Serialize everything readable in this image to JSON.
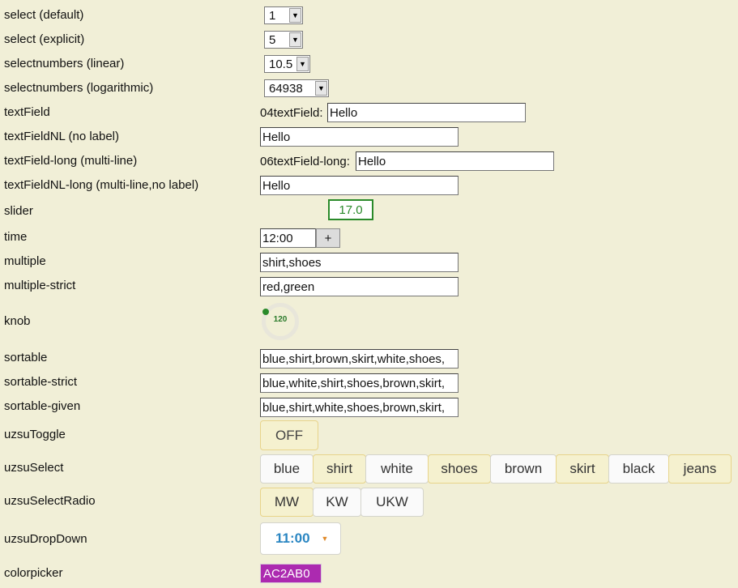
{
  "labels": {
    "select_default": "select (default)",
    "select_explicit": "select (explicit)",
    "selectnumbers_linear": "selectnumbers (linear)",
    "selectnumbers_log": "selectnumbers (logarithmic)",
    "textfield": "textField",
    "textfieldnl": "textFieldNL (no label)",
    "textfield_long": "textField-long (multi-line)",
    "textfieldnl_long": "textFieldNL-long (multi-line,no label)",
    "slider": "slider",
    "time": "time",
    "multiple": "multiple",
    "multiple_strict": "multiple-strict",
    "knob": "knob",
    "sortable": "sortable",
    "sortable_strict": "sortable-strict",
    "sortable_given": "sortable-given",
    "uzsu_toggle": "uzsuToggle",
    "uzsu_select": "uzsuSelect",
    "uzsu_select_radio": "uzsuSelectRadio",
    "uzsu_dropdown": "uzsuDropDown",
    "colorpicker": "colorpicker"
  },
  "values": {
    "select_default": "1",
    "select_explicit": "5",
    "selectnumbers_linear": "10.5",
    "selectnumbers_log": "64938",
    "textfield_prefix": "04textField:",
    "textfield": "Hello",
    "textfieldnl": "Hello",
    "textfield_long_prefix": "06textField-long:",
    "textfield_long": "Hello",
    "textfieldnl_long": "Hello",
    "slider": "17.0",
    "time": "12:00",
    "time_add": "+",
    "multiple": "shirt,shoes",
    "multiple_strict": "red,green",
    "knob": "120",
    "sortable": "blue,shirt,brown,skirt,white,shoes,",
    "sortable_strict": "blue,white,shirt,shoes,brown,skirt,",
    "sortable_given": "blue,shirt,white,shoes,brown,skirt,",
    "toggle": "OFF",
    "uzsu_select": [
      "blue",
      "shirt",
      "white",
      "shoes",
      "brown",
      "skirt",
      "black",
      "jeans"
    ],
    "uzsu_radio": [
      "MW",
      "KW",
      "UKW"
    ],
    "dropdown": "11:00",
    "colorpicker": "AC2AB0"
  },
  "colors": {
    "background": "#f1efd7",
    "accent_green": "#2a8a2a",
    "highlight": "#f5f1cf",
    "dropdown_blue": "#2a86c2",
    "color_swatch": "#ac2ab0"
  }
}
